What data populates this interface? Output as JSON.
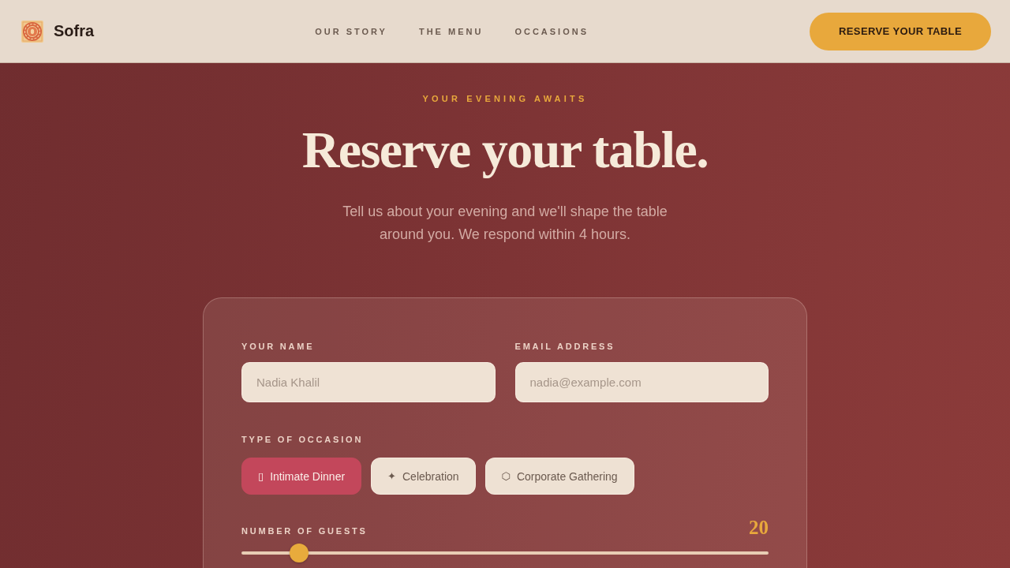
{
  "header": {
    "brand": "Sofra",
    "nav": [
      {
        "label": "OUR STORY"
      },
      {
        "label": "THE MENU"
      },
      {
        "label": "OCCASIONS"
      }
    ],
    "cta": "RESERVE YOUR TABLE"
  },
  "hero": {
    "eyebrow": "YOUR EVENING AWAITS",
    "title": "Reserve your table.",
    "subtitle": "Tell us about your evening and we'll shape the table around you. We respond within 4 hours."
  },
  "form": {
    "fields": [
      {
        "label": "YOUR NAME",
        "placeholder": "Nadia Khalil"
      },
      {
        "label": "EMAIL ADDRESS",
        "placeholder": "nadia@example.com"
      }
    ],
    "occasion": {
      "label": "TYPE OF OCCASION",
      "options": [
        {
          "icon": "▯",
          "label": "Intimate Dinner",
          "selected": true
        },
        {
          "icon": "✦",
          "label": "Celebration",
          "selected": false
        },
        {
          "icon": "⬡",
          "label": "Corporate Gathering",
          "selected": false
        }
      ]
    },
    "guests": {
      "label": "NUMBER OF GUESTS",
      "value": "20",
      "level": 0.11
    }
  }
}
